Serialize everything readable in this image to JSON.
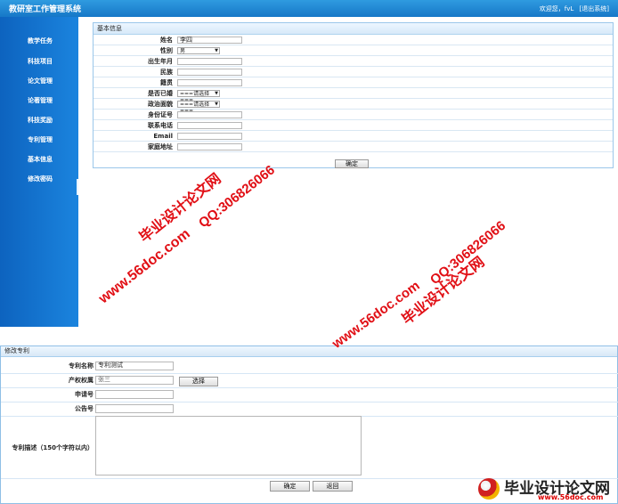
{
  "app": {
    "title": "教研室工作管理系统"
  },
  "userbar": {
    "welcome": "欢迎您，fvL",
    "logout": "[退出系统]"
  },
  "sidebar": {
    "items": [
      "教学任务",
      "科技项目",
      "论文管理",
      "论著管理",
      "科技奖励",
      "专利管理",
      "基本信息",
      "修改密码"
    ]
  },
  "basic_info": {
    "title": "基本信息",
    "fields": [
      {
        "label": "姓名",
        "value": "李四"
      },
      {
        "label": "性别",
        "value": "男"
      },
      {
        "label": "出生年月",
        "value": ""
      },
      {
        "label": "民族",
        "value": ""
      },
      {
        "label": "籍贯",
        "value": ""
      },
      {
        "label": "是否已婚",
        "value": "===请选择==="
      },
      {
        "label": "政治面貌",
        "value": "===请选择==="
      },
      {
        "label": "身份证号",
        "value": ""
      },
      {
        "label": "联系电话",
        "value": ""
      },
      {
        "label": "Email",
        "value": ""
      },
      {
        "label": "家庭地址",
        "value": ""
      }
    ],
    "submit": "确定"
  },
  "patent": {
    "title": "修改专利",
    "fields": [
      {
        "label": "专利名称",
        "value": "专利测试"
      },
      {
        "label": "产权权属",
        "value": "张三"
      },
      {
        "label": "申请号",
        "value": ""
      },
      {
        "label": "公告号",
        "value": ""
      }
    ],
    "select_button": "选择",
    "desc_label": "专利描述（150个字符以内）",
    "submit": "确定",
    "back": "返回"
  },
  "watermarks": [
    "毕业设计论文网",
    "QQ:306826066",
    "www.56doc.com",
    "www.56doc.com",
    "QQ:306826066",
    "毕业设计论文网"
  ],
  "logo": {
    "cn": "毕业设计论文网",
    "url": "www.56doc.com"
  }
}
